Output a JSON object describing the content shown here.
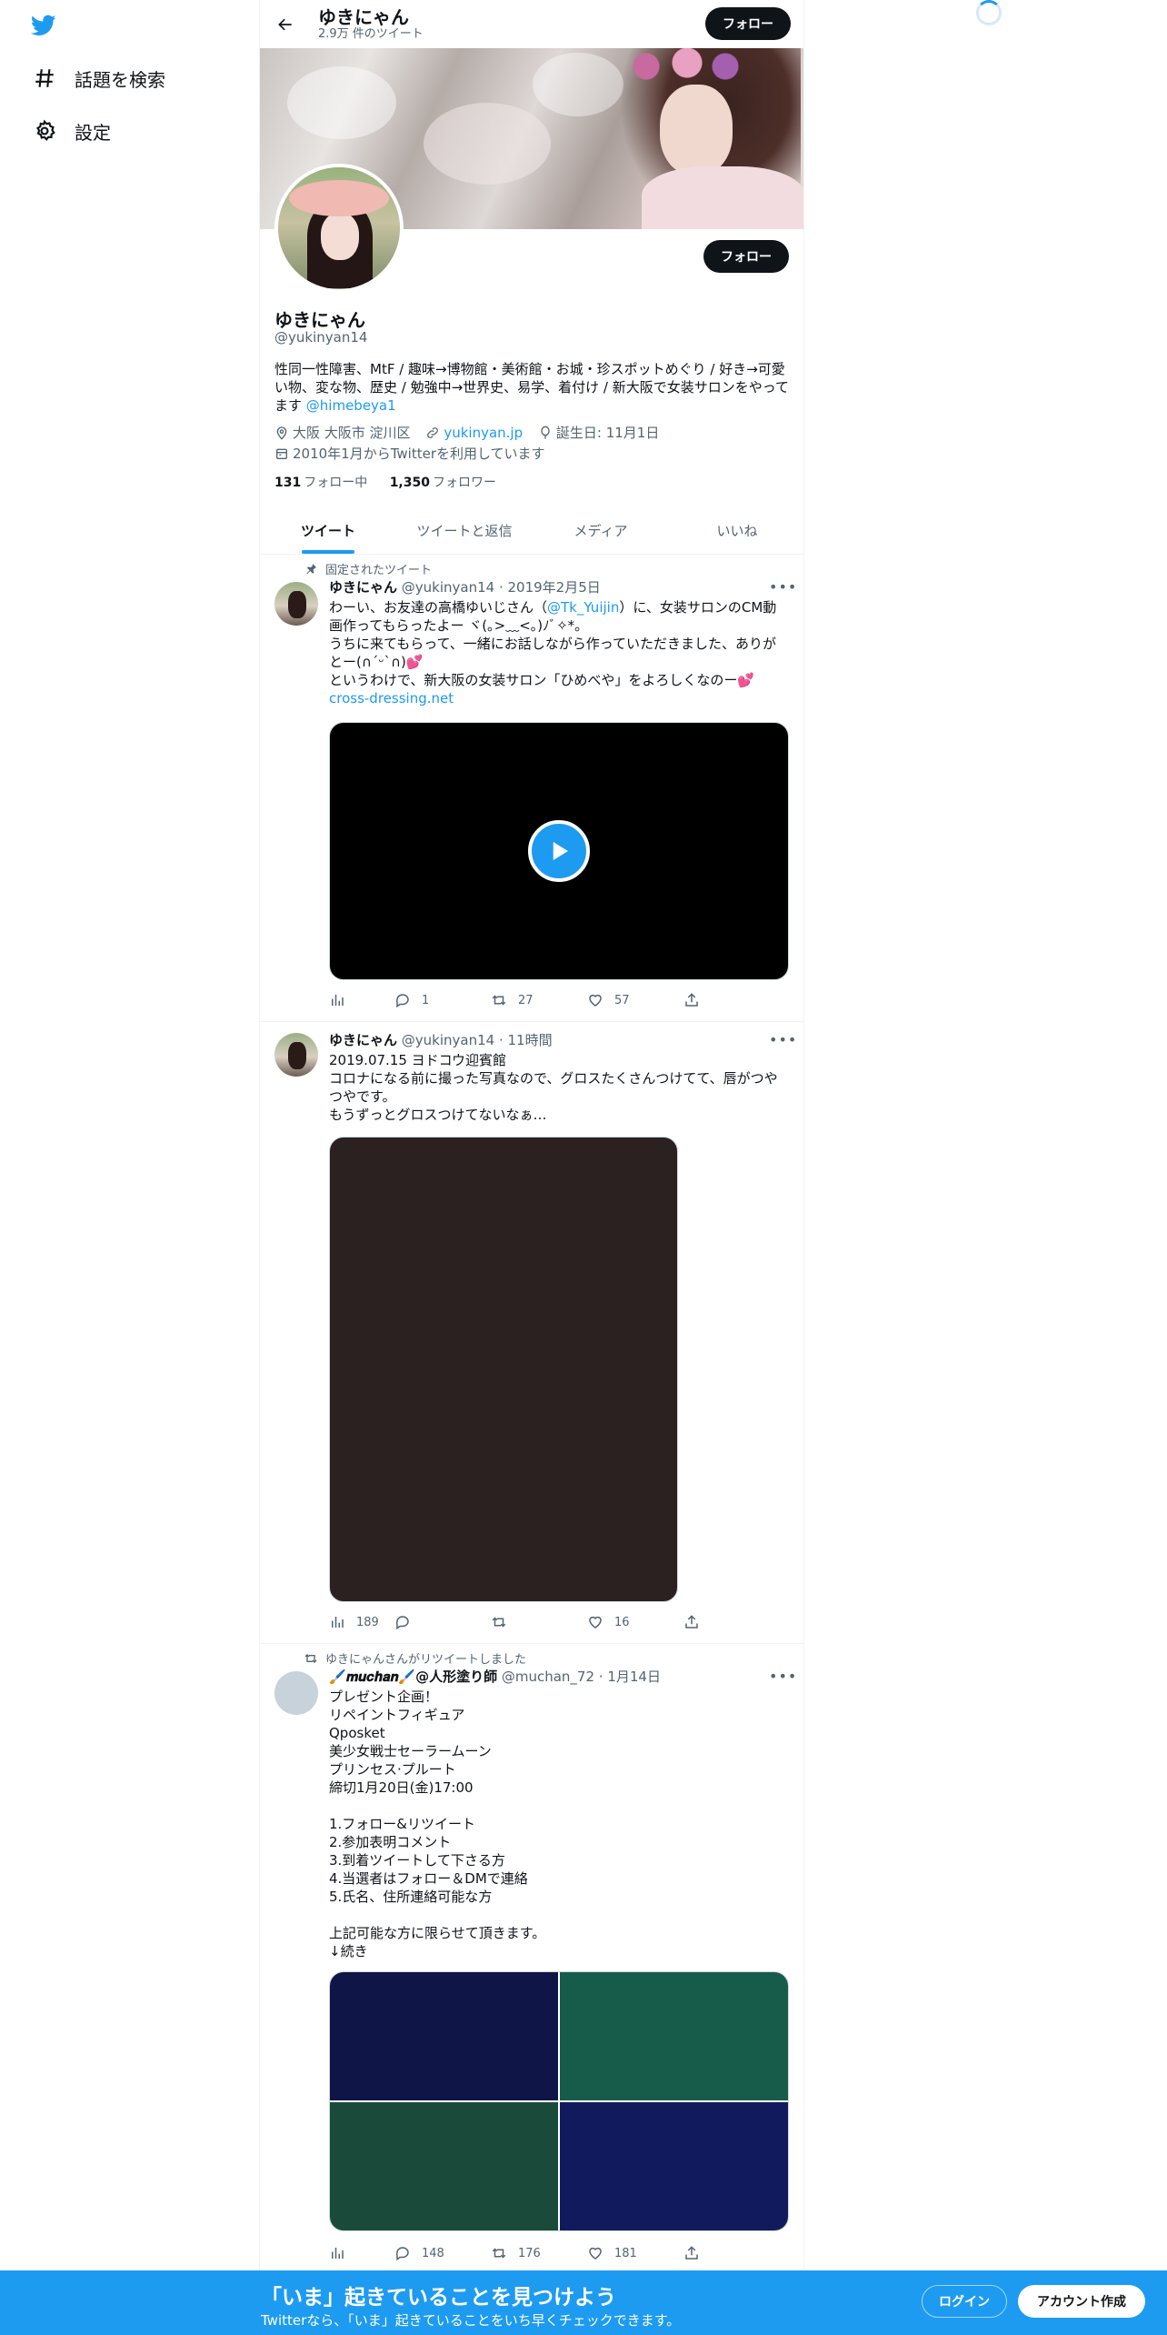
{
  "nav": {
    "logo_icon": "twitter-bird-icon",
    "items": [
      {
        "label": "話題を検索",
        "icon": "hashtag-icon"
      },
      {
        "label": "設定",
        "icon": "gear-icon"
      }
    ]
  },
  "header": {
    "name": "ゆきにゃん",
    "tweet_count": "2.9万 件のツイート",
    "follow_label": "フォロー"
  },
  "profile": {
    "name": "ゆきにゃん",
    "handle": "@yukinyan14",
    "follow_label": "フォロー",
    "bio_text": "性同一性障害、MtF / 趣味→博物館・美術館・お城・珍スポットめぐり / 好き→可愛い物、変な物、歴史 / 勉強中→世界史、易学、着付け / 新大阪で女装サロンをやってます ",
    "bio_mention": "@himebeya1",
    "location": "大阪 大阪市 淀川区",
    "website": "yukinyan.jp",
    "birthday": "誕生日: 11月1日",
    "joined": "2010年1月からTwitterを利用しています",
    "following_count": "131",
    "following_label": "フォロー中",
    "followers_count": "1,350",
    "followers_label": "フォロワー"
  },
  "tabs": [
    "ツイート",
    "ツイートと返信",
    "メディア",
    "いいね"
  ],
  "tweets": [
    {
      "social": "固定されたツイート",
      "name": "ゆきにゃん",
      "meta": "@yukinyan14 · 2019年2月5日",
      "text_1": "わーい、お友達の高橋ゆいじさん（",
      "mention": "@Tk_Yuijin",
      "text_2": "）に、女装サロンのCM動画作ってもらったよー ヾ(｡>﹏<｡)ﾉﾞ✧*。\nうちに来てもらって、一緒にお話しながら作っていただきました、ありがとー(∩ˊᵕˋ∩)💕\nというわけで、新大阪の女装サロン「ひめべや」をよろしくなのー💕",
      "link": "cross-dressing.net",
      "replies": "1",
      "retweets": "27",
      "likes": "57",
      "views": ""
    },
    {
      "name": "ゆきにゃん",
      "meta": "@yukinyan14 · 11時間",
      "text": "2019.07.15 ヨドコウ迎賓館\nコロナになる前に撮った写真なので、グロスたくさんつけてて、唇がつやつやです。\nもうずっとグロスつけてないなぁ…",
      "views": "189",
      "replies": "",
      "retweets": "",
      "likes": "16"
    },
    {
      "social": "ゆきにゃんさんがリツイートしました",
      "name": "🖌️𝒎𝒖𝒄𝒉𝒂𝒏🖌️@人形塗り師",
      "meta": "@muchan_72 · 1月14日",
      "text": "プレゼント企画！\nリペイントフィギュア\nQposket\n美少女戦士セーラームーン\nプリンセス·プルート\n締切1月20日(金)17:00\n\n1.フォロー&リツイート\n2.参加表明コメント\n3.到着ツイートして下さる方\n4.当選者はフォロー＆DMで連絡\n5.氏名、住所連絡可能な方\n\n上記可能な方に限らせて頂きます。\n↓続き",
      "views": "",
      "replies": "148",
      "retweets": "176",
      "likes": "181",
      "image_colors": [
        "#0f1547",
        "#175c4a",
        "#1a4b3a",
        "#121a5e"
      ]
    }
  ],
  "bottom": {
    "title": "「いま」起きていることを見つけよう",
    "subtitle": "Twitterなら、「いま」起きていることをいち早くチェックできます。",
    "login": "ログイン",
    "signup": "アカウント作成"
  },
  "colors": {
    "accent": "#1d9bf0",
    "text": "#0f1419",
    "secondary": "#536471",
    "video_bg": "#000000",
    "photo_bg": "#2a2120"
  }
}
